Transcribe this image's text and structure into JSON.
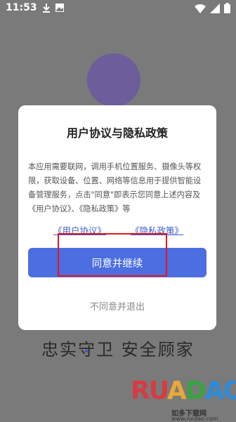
{
  "status_bar": {
    "time": "11:53",
    "left_icons": [
      "download-icon",
      "image-icon"
    ],
    "right_icons": [
      "wifi-icon",
      "signal-icon",
      "battery-icon"
    ]
  },
  "dialog": {
    "title": "用户协议与隐私政策",
    "body": "本应用需要联网，调用手机位置服务、摄像头等权限，获取设备、位置、网络等信息用于提供智能设备管理服务，点击\"同意\"即表示您同意上述内容及《用户协议》、《隐私政策》等",
    "link_user": "《用户协议》",
    "link_privacy": "《隐私政策》",
    "agree_label": "同意并继续",
    "decline_label": "不同意并退出"
  },
  "background": {
    "slogan": "忠实守卫 安全顾家"
  },
  "watermark": {
    "logo": "RUANDAO",
    "subtitle": "如多下载网",
    "url": "www.ruidao.com"
  }
}
